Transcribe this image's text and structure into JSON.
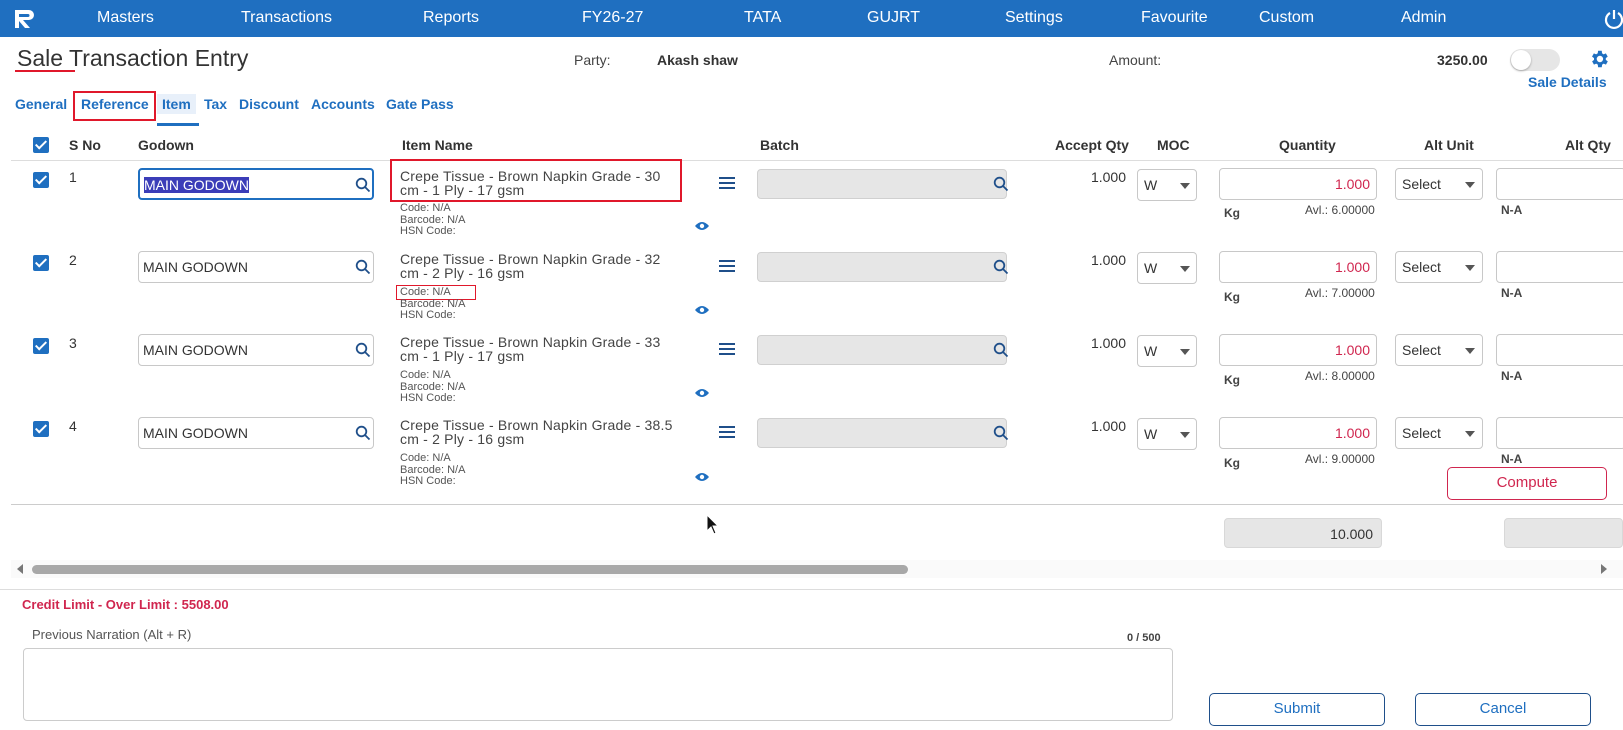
{
  "nav": {
    "items": [
      "Masters",
      "Transactions",
      "Reports",
      "FY26-27",
      "TATA",
      "GUJRT",
      "Settings",
      "Favourite",
      "Custom",
      "Admin"
    ]
  },
  "header": {
    "title": "Sale Transaction Entry",
    "party_label": "Party:",
    "party_value": "Akash shaw",
    "amount_label": "Amount:",
    "amount_value": "3250.00",
    "sale_details": "Sale Details"
  },
  "tabs": [
    "General",
    "Reference",
    "Item",
    "Tax",
    "Discount",
    "Accounts",
    "Gate Pass"
  ],
  "active_tab": "Item",
  "columns": {
    "sno": "S No",
    "godown": "Godown",
    "item_name": "Item Name",
    "batch": "Batch",
    "accept_qty": "Accept Qty",
    "moc": "MOC",
    "quantity": "Quantity",
    "alt_unit": "Alt Unit",
    "alt_qty": "Alt Qty"
  },
  "rows": [
    {
      "sno": "1",
      "godown": "MAIN GODOWN",
      "item_name": "Crepe Tissue - Brown Napkin Grade - 30 cm - 1 Ply - 17 gsm",
      "code": "Code: N/A",
      "barcode": "Barcode: N/A",
      "hsn": "HSN Code:",
      "accept_qty": "1.000",
      "moc": "W",
      "quantity": "1.000",
      "unit": "Kg",
      "avl": "Avl.: 6.00000",
      "alt_unit": "Select",
      "alt_na": "N-A"
    },
    {
      "sno": "2",
      "godown": "MAIN GODOWN",
      "item_name": "Crepe Tissue - Brown Napkin Grade - 32 cm - 2 Ply - 16 gsm",
      "code": "Code: N/A",
      "barcode": "Barcode: N/A",
      "hsn": "HSN Code:",
      "accept_qty": "1.000",
      "moc": "W",
      "quantity": "1.000",
      "unit": "Kg",
      "avl": "Avl.: 7.00000",
      "alt_unit": "Select",
      "alt_na": "N-A"
    },
    {
      "sno": "3",
      "godown": "MAIN GODOWN",
      "item_name": "Crepe Tissue - Brown Napkin Grade - 33 cm - 1 Ply - 17 gsm",
      "code": "Code: N/A",
      "barcode": "Barcode: N/A",
      "hsn": "HSN Code:",
      "accept_qty": "1.000",
      "moc": "W",
      "quantity": "1.000",
      "unit": "Kg",
      "avl": "Avl.: 8.00000",
      "alt_unit": "Select",
      "alt_na": "N-A"
    },
    {
      "sno": "4",
      "godown": "MAIN GODOWN",
      "item_name": "Crepe Tissue - Brown Napkin Grade - 38.5 cm - 2 Ply - 16 gsm",
      "code": "Code: N/A",
      "barcode": "Barcode: N/A",
      "hsn": "HSN Code:",
      "accept_qty": "1.000",
      "moc": "W",
      "quantity": "1.000",
      "unit": "Kg",
      "avl": "Avl.: 9.00000",
      "alt_unit": "Select",
      "alt_na": "N-A"
    }
  ],
  "compute_label": "Compute",
  "total_quantity": "10.000",
  "credit_limit": "Credit Limit - Over Limit : 5508.00",
  "narration": {
    "label": "Previous Narration (Alt + R)",
    "count": "0 / 500",
    "value": ""
  },
  "buttons": {
    "submit": "Submit",
    "cancel": "Cancel"
  },
  "colors": {
    "nav_bg": "#1f6fc0",
    "accent": "#1f6fc0",
    "alert": "#d0264f",
    "highlight_box": "#e0182b"
  }
}
